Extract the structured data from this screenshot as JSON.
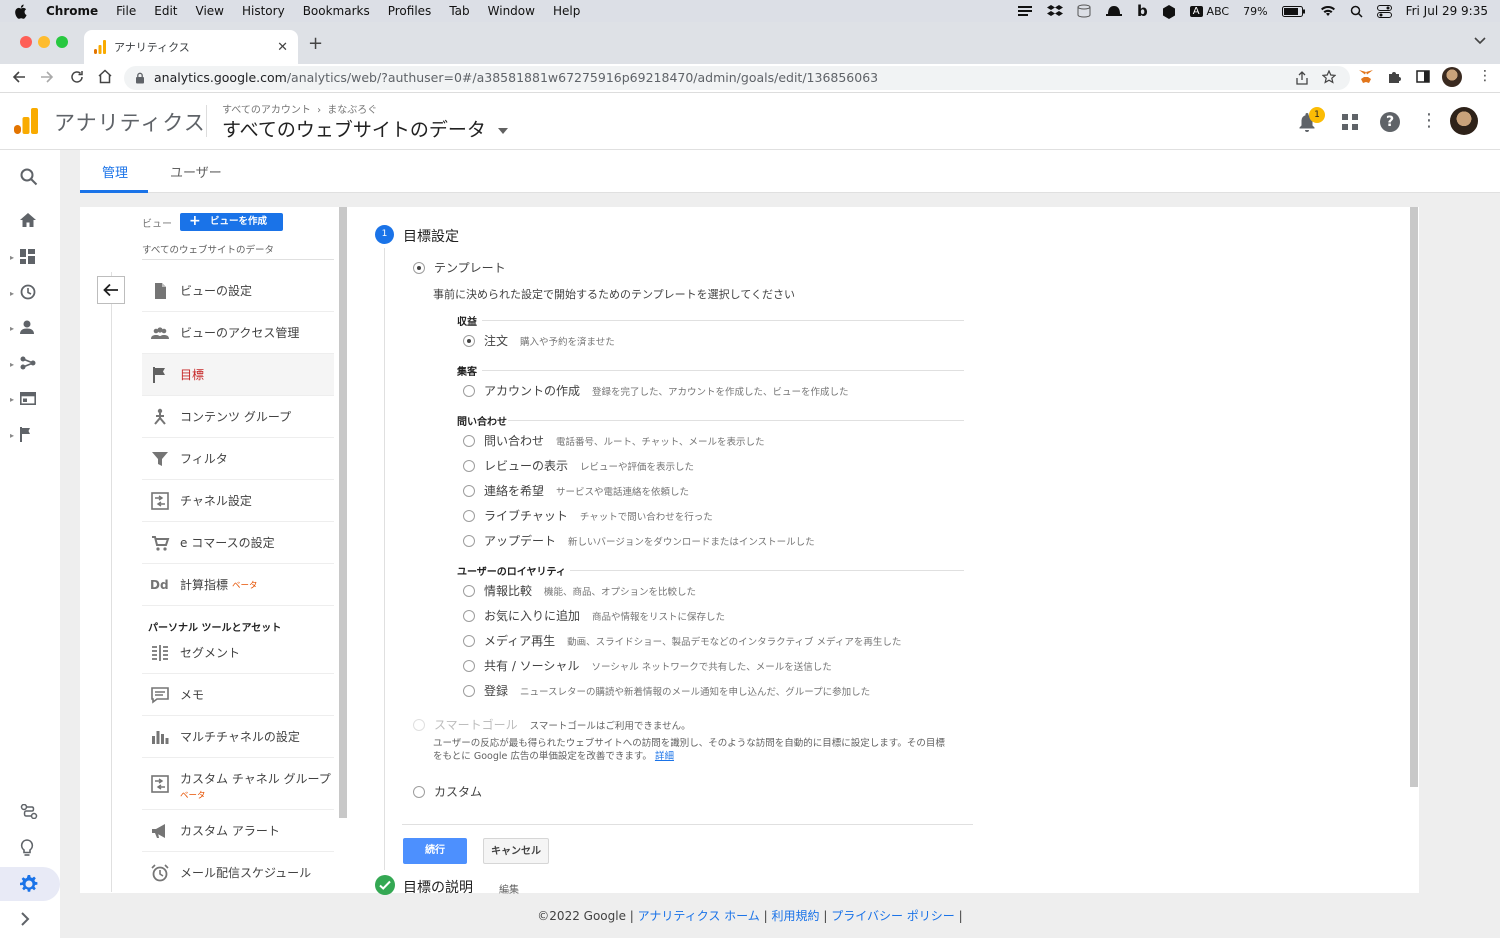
{
  "menubar": {
    "app": "Chrome",
    "items": [
      "File",
      "Edit",
      "View",
      "History",
      "Bookmarks",
      "Profiles",
      "Tab",
      "Window",
      "Help"
    ],
    "input_source": "ABC",
    "battery": "79%",
    "datetime": "Fri Jul 29  9:35"
  },
  "browser": {
    "tab_title": "アナリティクス",
    "url_host": "analytics.google.com",
    "url_path": "/analytics/web/?authuser=0#/a38581881w67275916p69218470/admin/goals/edit/136856063"
  },
  "header": {
    "product": "アナリティクス",
    "crumb_account": "すべてのアカウント",
    "crumb_property": "まなぶろぐ",
    "view_name": "すべてのウェブサイトのデータ",
    "notification_count": "1"
  },
  "tabs": {
    "admin": "管理",
    "user": "ユーザー"
  },
  "nav": {
    "view_label": "ビュー",
    "create_view": "ビューを作成",
    "view_name": "すべてのウェブサイトのデータ",
    "items": [
      {
        "label": "ビューの設定",
        "icon": "document-icon"
      },
      {
        "label": "ビューのアクセス管理",
        "icon": "people-icon"
      },
      {
        "label": "目標",
        "icon": "flag-icon"
      },
      {
        "label": "コンテンツ グループ",
        "icon": "content-group-icon"
      },
      {
        "label": "フィルタ",
        "icon": "filter-icon"
      },
      {
        "label": "チャネル設定",
        "icon": "channel-settings-icon"
      },
      {
        "label": "e コマースの設定",
        "icon": "cart-icon"
      },
      {
        "label": "計算指標",
        "icon": "calculated-metric-icon",
        "beta": "ベータ"
      }
    ],
    "personal_heading": "パーソナル ツールとアセット",
    "personal_items": [
      {
        "label": "セグメント",
        "icon": "segment-icon"
      },
      {
        "label": "メモ",
        "icon": "memo-icon"
      },
      {
        "label": "マルチチャネルの設定",
        "icon": "bar-chart-icon"
      },
      {
        "label": "カスタム チャネル グループ",
        "icon": "custom-channel-icon",
        "beta": "ベータ"
      },
      {
        "label": "カスタム アラート",
        "icon": "megaphone-icon"
      },
      {
        "label": "メール配信スケジュール",
        "icon": "alarm-clock-icon"
      }
    ]
  },
  "goal": {
    "step1_number": "1",
    "step1_title": "目標設定",
    "template_label": "テンプレート",
    "template_desc": "事前に決められた設定で開始するためのテンプレートを選択してください",
    "sections": [
      {
        "heading": "収益",
        "options": [
          {
            "label": "注文",
            "desc": "購入や予約を済ませた",
            "checked": true
          }
        ]
      },
      {
        "heading": "集客",
        "options": [
          {
            "label": "アカウントの作成",
            "desc": "登録を完了した、アカウントを作成した、ビューを作成した"
          }
        ]
      },
      {
        "heading": "問い合わせ",
        "options": [
          {
            "label": "問い合わせ",
            "desc": "電話番号、ルート、チャット、メールを表示した"
          },
          {
            "label": "レビューの表示",
            "desc": "レビューや評価を表示した"
          },
          {
            "label": "連絡を希望",
            "desc": "サービスや電話連絡を依頼した"
          },
          {
            "label": "ライブチャット",
            "desc": "チャットで問い合わせを行った"
          },
          {
            "label": "アップデート",
            "desc": "新しいバージョンをダウンロードまたはインストールした"
          }
        ]
      },
      {
        "heading": "ユーザーのロイヤリティ",
        "options": [
          {
            "label": "情報比較",
            "desc": "機能、商品、オプションを比較した"
          },
          {
            "label": "お気に入りに追加",
            "desc": "商品や情報をリストに保存した"
          },
          {
            "label": "メディア再生",
            "desc": "動画、スライドショー、製品デモなどのインタラクティブ メディアを再生した"
          },
          {
            "label": "共有 / ソーシャル",
            "desc": "ソーシャル ネットワークで共有した、メールを送信した"
          },
          {
            "label": "登録",
            "desc": "ニュースレターの購読や新着情報のメール通知を申し込んだ、グループに参加した"
          }
        ]
      }
    ],
    "smart_label": "スマートゴール",
    "smart_unavailable": "スマートゴールはご利用できません。",
    "smart_desc_1": "ユーザーの反応が最も得られたウェブサイトへの訪問を識別し、そのような訪問を自動的に目標に設定します。その目標",
    "smart_desc_2": "をもとに Google 広告の単価設定を改善できます。",
    "smart_link": "詳細",
    "custom_label": "カスタム",
    "continue": "続行",
    "cancel": "キャンセル",
    "step2_title": "目標の説明",
    "step2_edit": "編集"
  },
  "footer": {
    "copyright": "©2022 Google",
    "home": "アナリティクス ホーム",
    "terms": "利用規約",
    "privacy": "プライバシー ポリシー",
    "sep": "|"
  },
  "colors": {
    "accent": "#4285f4",
    "active_nav": "#c62828",
    "beta": "#e65100",
    "success": "#34a853"
  }
}
